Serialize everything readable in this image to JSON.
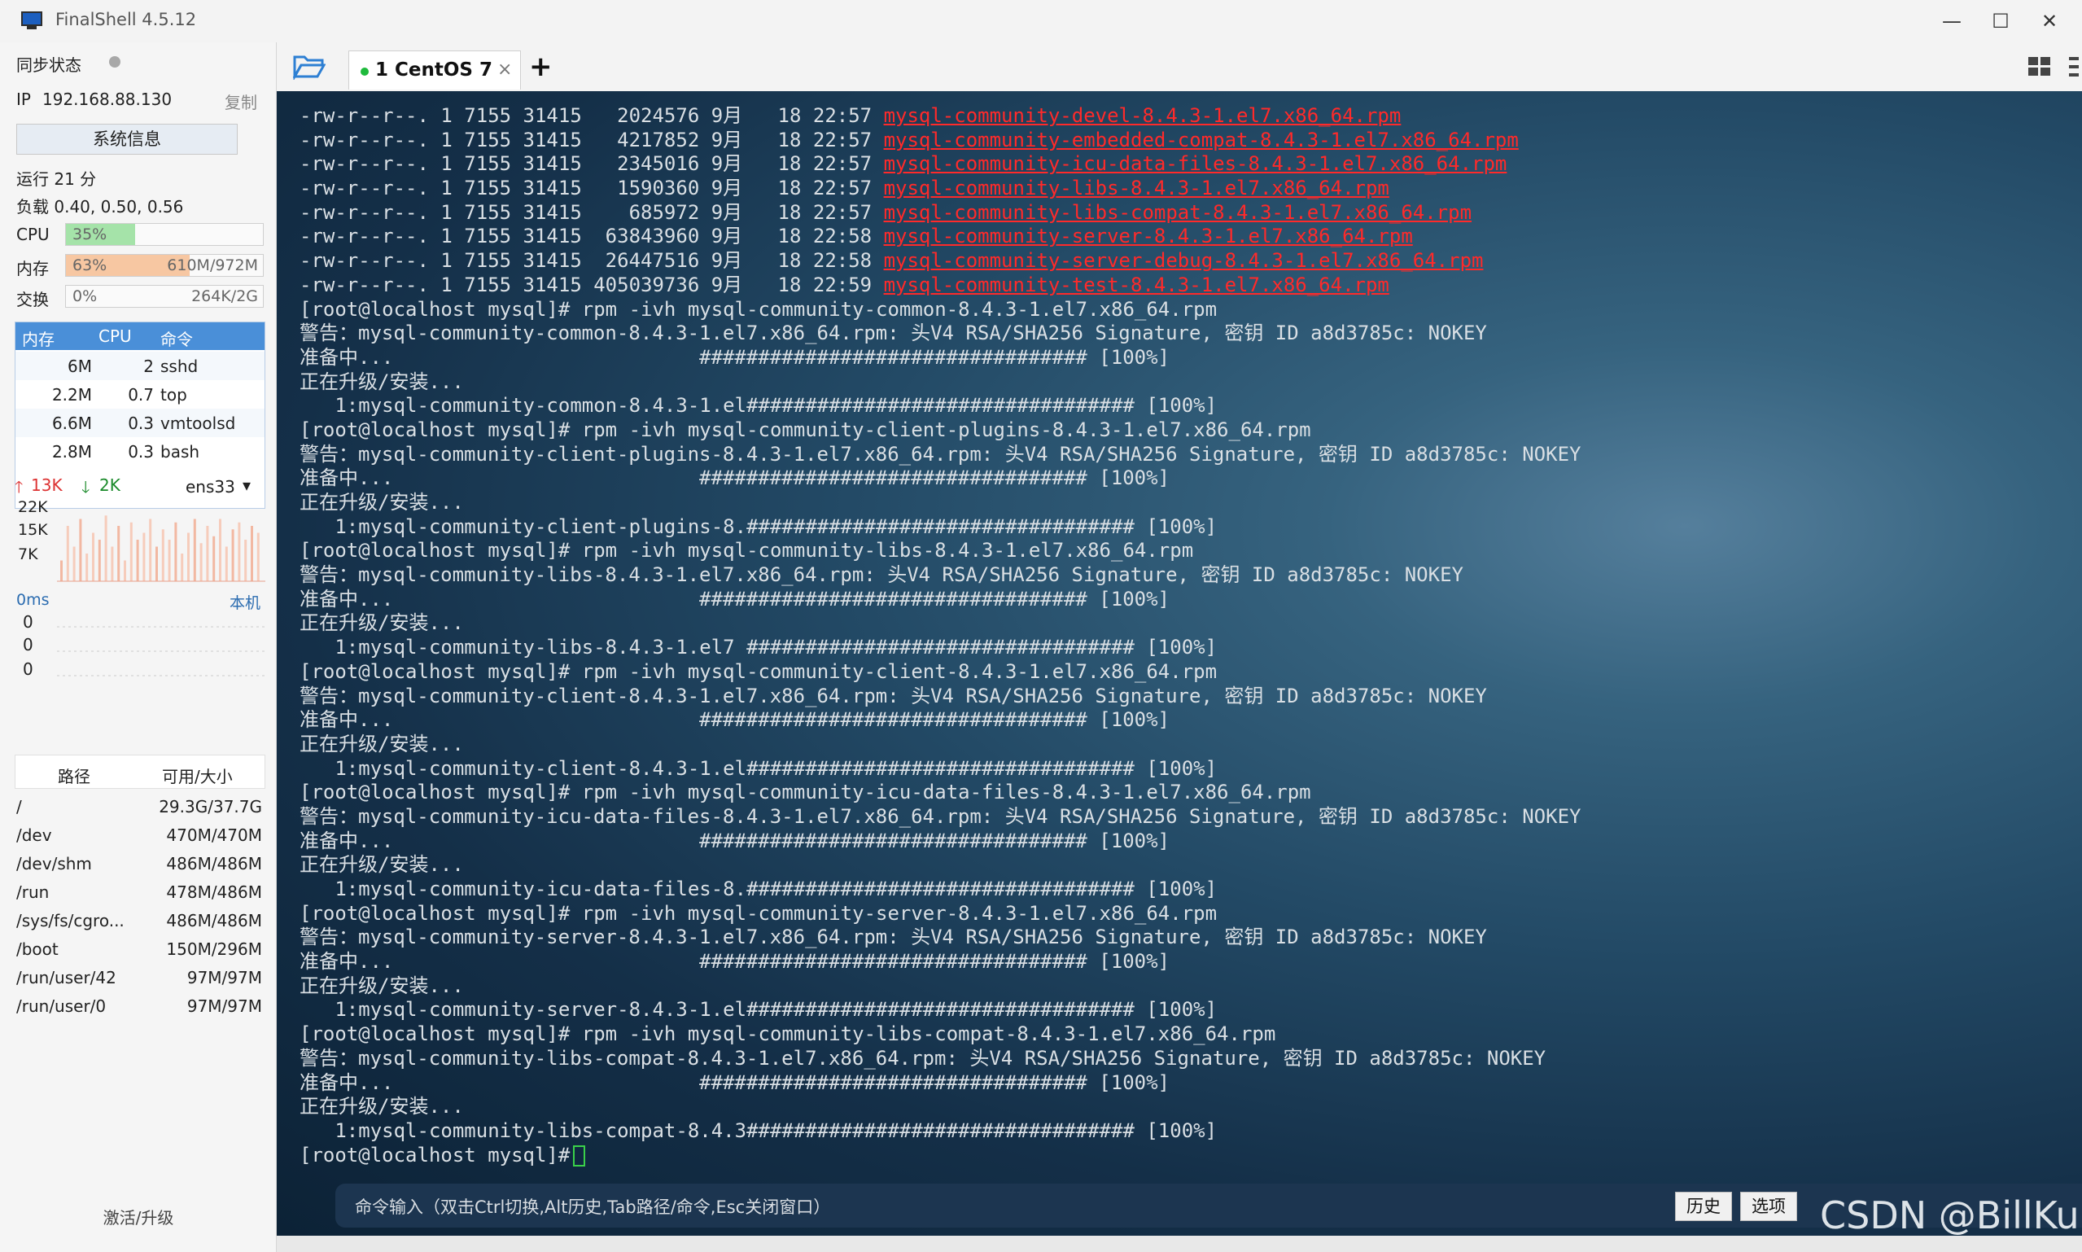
{
  "window": {
    "title": "FinalShell 4.5.12",
    "controls": [
      "—",
      "☐",
      "✕"
    ]
  },
  "sidebar": {
    "sync_label": "同步状态",
    "ip_label": "IP",
    "ip": "192.168.88.130",
    "copy": "复制",
    "sysinfo_button": "系统信息",
    "uptime": "运行 21 分",
    "load": "负载 0.40, 0.50, 0.56",
    "cpu": {
      "label": "CPU",
      "percent": "35%",
      "fill": 0.35
    },
    "mem": {
      "label": "内存",
      "percent": "63%",
      "value": "610M/972M",
      "fill": 0.63
    },
    "swap": {
      "label": "交换",
      "percent": "0%",
      "value": "264K/2G",
      "fill": 0.0
    },
    "process_table": {
      "headers": [
        "内存",
        "CPU",
        "命令"
      ],
      "rows": [
        {
          "mem": "6M",
          "cpu": "2",
          "cmd": "sshd"
        },
        {
          "mem": "2.2M",
          "cpu": "0.7",
          "cmd": "top"
        },
        {
          "mem": "6.6M",
          "cpu": "0.3",
          "cmd": "vmtoolsd"
        },
        {
          "mem": "2.8M",
          "cpu": "0.3",
          "cmd": "bash"
        }
      ]
    },
    "network": {
      "up": "13K",
      "down": "2K",
      "interface": "ens33",
      "y_ticks": [
        "22K",
        "15K",
        "7K"
      ]
    },
    "ping": {
      "latency": "0ms",
      "target": "本机",
      "y_ticks": [
        "0",
        "0",
        "0"
      ]
    },
    "disk_table": {
      "headers": [
        "路径",
        "可用/大小"
      ],
      "rows": [
        {
          "path": "/",
          "size": "29.3G/37.7G"
        },
        {
          "path": "/dev",
          "size": "470M/470M"
        },
        {
          "path": "/dev/shm",
          "size": "486M/486M"
        },
        {
          "path": "/run",
          "size": "478M/486M"
        },
        {
          "path": "/sys/fs/cgro...",
          "size": "486M/486M"
        },
        {
          "path": "/boot",
          "size": "150M/296M"
        },
        {
          "path": "/run/user/42",
          "size": "97M/97M"
        },
        {
          "path": "/run/user/0",
          "size": "97M/97M"
        }
      ]
    },
    "upgrade": "激活/升级"
  },
  "tabs": {
    "active_label": "1 CentOS 7",
    "close": "×",
    "add": "+"
  },
  "terminal": {
    "lines": [
      {
        "pre": "-rw-r--r--. 1 7155 31415   2024576 9月   18 22:57 ",
        "red": "mysql-community-devel-8.4.3-1.el7.x86_64.rpm"
      },
      {
        "pre": "-rw-r--r--. 1 7155 31415   4217852 9月   18 22:57 ",
        "red": "mysql-community-embedded-compat-8.4.3-1.el7.x86_64.rpm"
      },
      {
        "pre": "-rw-r--r--. 1 7155 31415   2345016 9月   18 22:57 ",
        "red": "mysql-community-icu-data-files-8.4.3-1.el7.x86_64.rpm"
      },
      {
        "pre": "-rw-r--r--. 1 7155 31415   1590360 9月   18 22:57 ",
        "red": "mysql-community-libs-8.4.3-1.el7.x86_64.rpm"
      },
      {
        "pre": "-rw-r--r--. 1 7155 31415    685972 9月   18 22:57 ",
        "red": "mysql-community-libs-compat-8.4.3-1.el7.x86_64.rpm"
      },
      {
        "pre": "-rw-r--r--. 1 7155 31415  63843960 9月   18 22:58 ",
        "red": "mysql-community-server-8.4.3-1.el7.x86_64.rpm"
      },
      {
        "pre": "-rw-r--r--. 1 7155 31415  26447516 9月   18 22:58 ",
        "red": "mysql-community-server-debug-8.4.3-1.el7.x86_64.rpm"
      },
      {
        "pre": "-rw-r--r--. 1 7155 31415 405039736 9月   18 22:59 ",
        "red": "mysql-community-test-8.4.3-1.el7.x86_64.rpm"
      },
      {
        "pre": "[root@localhost mysql]# rpm -ivh mysql-community-common-8.4.3-1.el7.x86_64.rpm",
        "red": ""
      },
      {
        "pre": "警告：mysql-community-common-8.4.3-1.el7.x86_64.rpm: 头V4 RSA/SHA256 Signature, 密钥 ID a8d3785c: NOKEY",
        "red": ""
      },
      {
        "pre": "准备中...                          ################################# [100%]",
        "red": ""
      },
      {
        "pre": "正在升级/安装...",
        "red": ""
      },
      {
        "pre": "   1:mysql-community-common-8.4.3-1.el################################# [100%]",
        "red": ""
      },
      {
        "pre": "[root@localhost mysql]# rpm -ivh mysql-community-client-plugins-8.4.3-1.el7.x86_64.rpm",
        "red": ""
      },
      {
        "pre": "警告：mysql-community-client-plugins-8.4.3-1.el7.x86_64.rpm: 头V4 RSA/SHA256 Signature, 密钥 ID a8d3785c: NOKEY",
        "red": ""
      },
      {
        "pre": "准备中...                          ################################# [100%]",
        "red": ""
      },
      {
        "pre": "正在升级/安装...",
        "red": ""
      },
      {
        "pre": "   1:mysql-community-client-plugins-8.################################# [100%]",
        "red": ""
      },
      {
        "pre": "[root@localhost mysql]# rpm -ivh mysql-community-libs-8.4.3-1.el7.x86_64.rpm",
        "red": ""
      },
      {
        "pre": "警告：mysql-community-libs-8.4.3-1.el7.x86_64.rpm: 头V4 RSA/SHA256 Signature, 密钥 ID a8d3785c: NOKEY",
        "red": ""
      },
      {
        "pre": "准备中...                          ################################# [100%]",
        "red": ""
      },
      {
        "pre": "正在升级/安装...",
        "red": ""
      },
      {
        "pre": "   1:mysql-community-libs-8.4.3-1.el7 ################################# [100%]",
        "red": ""
      },
      {
        "pre": "[root@localhost mysql]# rpm -ivh mysql-community-client-8.4.3-1.el7.x86_64.rpm",
        "red": ""
      },
      {
        "pre": "警告：mysql-community-client-8.4.3-1.el7.x86_64.rpm: 头V4 RSA/SHA256 Signature, 密钥 ID a8d3785c: NOKEY",
        "red": ""
      },
      {
        "pre": "准备中...                          ################################# [100%]",
        "red": ""
      },
      {
        "pre": "正在升级/安装...",
        "red": ""
      },
      {
        "pre": "   1:mysql-community-client-8.4.3-1.el################################# [100%]",
        "red": ""
      },
      {
        "pre": "[root@localhost mysql]# rpm -ivh mysql-community-icu-data-files-8.4.3-1.el7.x86_64.rpm",
        "red": ""
      },
      {
        "pre": "警告：mysql-community-icu-data-files-8.4.3-1.el7.x86_64.rpm: 头V4 RSA/SHA256 Signature, 密钥 ID a8d3785c: NOKEY",
        "red": ""
      },
      {
        "pre": "准备中...                          ################################# [100%]",
        "red": ""
      },
      {
        "pre": "正在升级/安装...",
        "red": ""
      },
      {
        "pre": "   1:mysql-community-icu-data-files-8.################################# [100%]",
        "red": ""
      },
      {
        "pre": "[root@localhost mysql]# rpm -ivh mysql-community-server-8.4.3-1.el7.x86_64.rpm",
        "red": ""
      },
      {
        "pre": "警告：mysql-community-server-8.4.3-1.el7.x86_64.rpm: 头V4 RSA/SHA256 Signature, 密钥 ID a8d3785c: NOKEY",
        "red": ""
      },
      {
        "pre": "准备中...                          ################################# [100%]",
        "red": ""
      },
      {
        "pre": "正在升级/安装...",
        "red": ""
      },
      {
        "pre": "   1:mysql-community-server-8.4.3-1.el################################# [100%]",
        "red": ""
      },
      {
        "pre": "[root@localhost mysql]# rpm -ivh mysql-community-libs-compat-8.4.3-1.el7.x86_64.rpm",
        "red": ""
      },
      {
        "pre": "警告：mysql-community-libs-compat-8.4.3-1.el7.x86_64.rpm: 头V4 RSA/SHA256 Signature, 密钥 ID a8d3785c: NOKEY",
        "red": ""
      },
      {
        "pre": "准备中...                          ################################# [100%]",
        "red": ""
      },
      {
        "pre": "正在升级/安装...",
        "red": ""
      },
      {
        "pre": "   1:mysql-community-libs-compat-8.4.3################################# [100%]",
        "red": ""
      }
    ],
    "prompt": "[root@localhost mysql]#"
  },
  "command_bar": {
    "hint": "命令输入（双击Ctrl切换,Alt历史,Tab路径/命令,Esc关闭窗口）",
    "history_button": "历史",
    "options_button": "选项"
  },
  "watermark": "CSDN @BillKu",
  "colors": {
    "accent": "#4a8fd8",
    "cpu_fill": "#a5e3a9",
    "mem_fill": "#f7c7a2",
    "file_red": "#ff2a2a",
    "cursor_green": "#3ad14a"
  }
}
